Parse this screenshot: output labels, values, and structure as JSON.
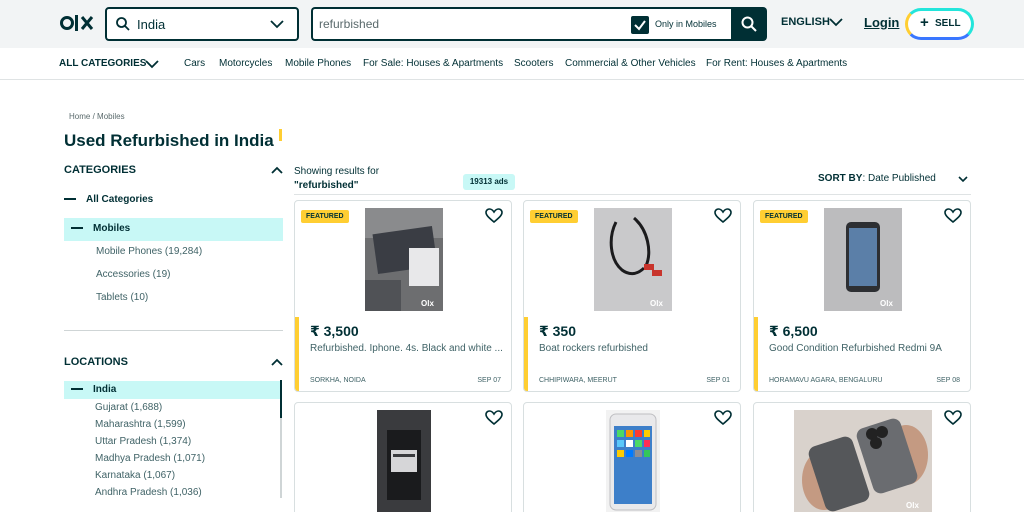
{
  "header": {
    "location_value": "India",
    "search_value": "refurbished",
    "only_in_mobiles_label": "Only in Mobiles",
    "language": "ENGLISH",
    "login_label": "Login",
    "sell_label": "SELL"
  },
  "category_nav": {
    "all_label": "ALL CATEGORIES",
    "items": [
      "Cars",
      "Motorcycles",
      "Mobile Phones",
      "For Sale: Houses & Apartments",
      "Scooters",
      "Commercial & Other Vehicles",
      "For Rent: Houses & Apartments"
    ]
  },
  "breadcrumb": [
    "Home",
    "Mobiles"
  ],
  "page_title": "Used Refurbished in India",
  "sidebar": {
    "categories_heading": "CATEGORIES",
    "all_categories": "All Categories",
    "active_category": "Mobiles",
    "subcategories": [
      "Mobile Phones (19,284)",
      "Accessories (19)",
      "Tablets (10)"
    ],
    "locations_heading": "LOCATIONS",
    "active_location": "India",
    "locations": [
      "Gujarat (1,688)",
      "Maharashtra (1,599)",
      "Uttar Pradesh (1,374)",
      "Madhya Pradesh (1,071)",
      "Karnataka (1,067)",
      "Andhra Pradesh (1,036)"
    ]
  },
  "results": {
    "showing_label": "Showing results for",
    "query": "\"refurbished\"",
    "ads_count": "19313 ads",
    "sort_label": "SORT BY",
    "sort_value": ": Date Published"
  },
  "listings": [
    {
      "featured": "FEATURED",
      "price": "₹ 3,500",
      "title": "Refurbished. Iphone. 4s. Black and white ...",
      "location": "SORKHA, NOIDA",
      "date": "SEP 07"
    },
    {
      "featured": "FEATURED",
      "price": "₹ 350",
      "title": "Boat rockers refurbished",
      "location": "CHHIPIWARA, MEERUT",
      "date": "SEP 01"
    },
    {
      "featured": "FEATURED",
      "price": "₹ 6,500",
      "title": "Good Condition Refurbished Redmi 9A",
      "location": "HORAMAVU AGARA, BENGALURU",
      "date": "SEP 08"
    },
    {
      "featured": "",
      "price": "",
      "title": "",
      "location": "",
      "date": ""
    },
    {
      "featured": "",
      "price": "",
      "title": "",
      "location": "",
      "date": ""
    },
    {
      "featured": "",
      "price": "",
      "title": "",
      "location": "",
      "date": ""
    }
  ],
  "colors": {
    "brand_dark": "#002f34",
    "featured_yellow": "#ffce32",
    "highlight_teal": "#c8f8f6"
  }
}
